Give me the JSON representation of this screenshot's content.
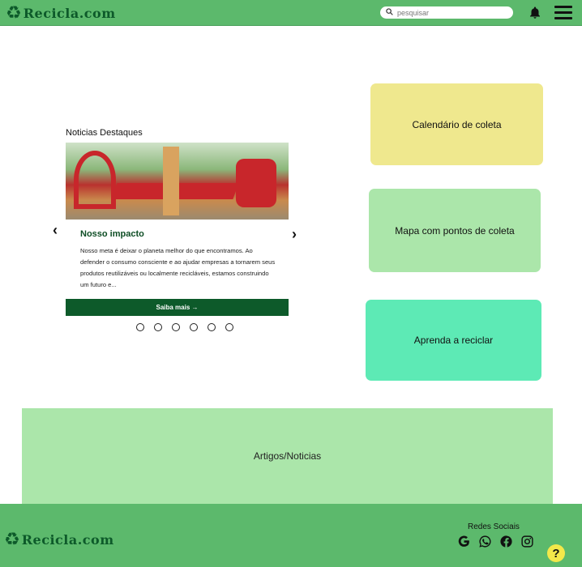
{
  "header": {
    "brand": "Recicla.com",
    "search_placeholder": "pesquisar"
  },
  "news": {
    "heading": "Noticias Destaques",
    "title": "Nosso impacto",
    "text": "Nosso meta é deixar o planeta melhor do que encontramos. Ao defender o consumo consciente e ao ajudar empresas a tornarem seus produtos reutilizáveis ou localmente recicláveis, estamos construindo um futuro e...",
    "button": "Saiba mais →",
    "prev": "‹",
    "next": "›"
  },
  "features": {
    "calendar": "Calendário de coleta",
    "map": "Mapa com pontos de coleta",
    "learn": "Aprenda a reciclar"
  },
  "articles": {
    "label": "Artigos/Noticias"
  },
  "footer": {
    "brand": "Recicla.com",
    "social_title": "Redes Sociais",
    "help": "?"
  },
  "colors": {
    "header": "#5cb96c",
    "brand": "#0d5a2a",
    "calendar_bg": "#efe88e",
    "map_bg": "#abe6aa",
    "learn_bg": "#5deab5",
    "button_bg": "#0d5a2a",
    "help_bg": "#f3e84a"
  },
  "icons": [
    "recycle-icon",
    "search-icon",
    "bell-icon",
    "menu-icon",
    "google-icon",
    "whatsapp-icon",
    "facebook-icon",
    "instagram-icon",
    "help-icon"
  ]
}
